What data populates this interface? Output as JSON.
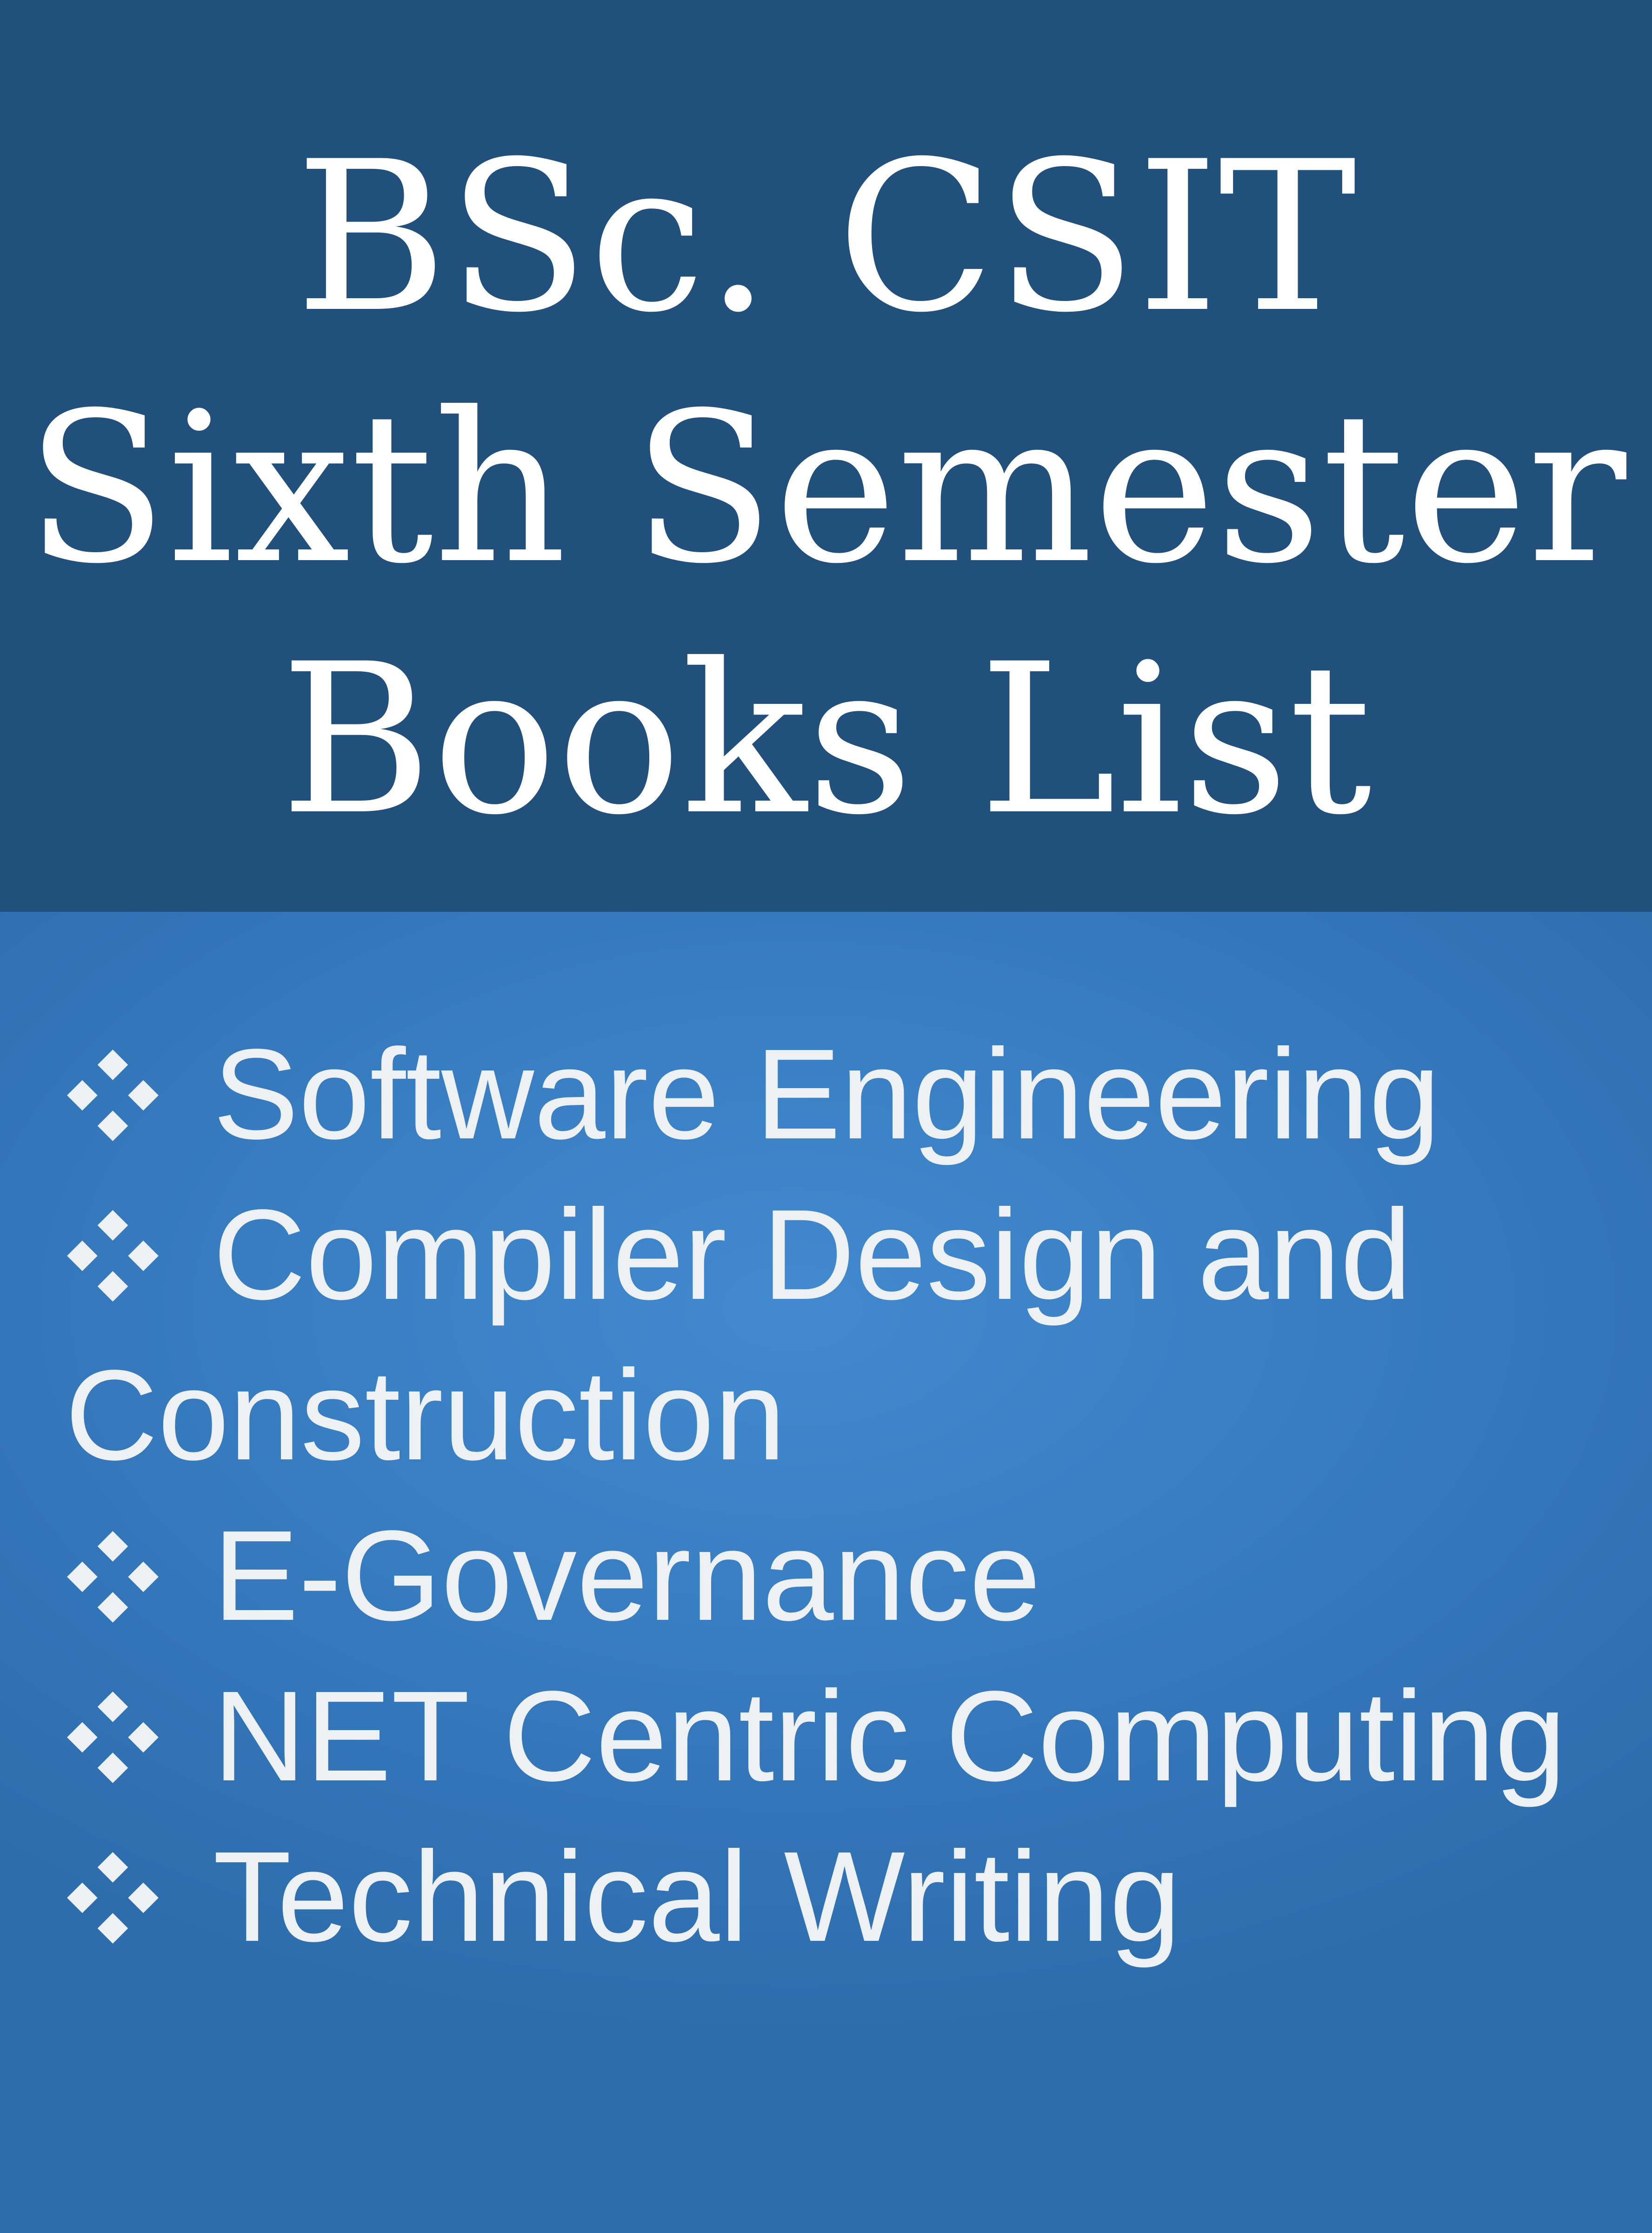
{
  "header": {
    "title_lines": [
      "BSc. CSIT",
      "Sixth Semester",
      "Books List"
    ]
  },
  "books": [
    {
      "lines": [
        "Software Engineering"
      ],
      "icon": "diamond-bullet-icon"
    },
    {
      "lines": [
        "Compiler Design and",
        "Construction"
      ],
      "icon": "diamond-bullet-icon"
    },
    {
      "lines": [
        "E-Governance"
      ],
      "icon": "diamond-bullet-icon"
    },
    {
      "lines": [
        "NET Centric Computing"
      ],
      "icon": "diamond-bullet-icon"
    },
    {
      "lines": [
        "Technical Writing"
      ],
      "icon": "diamond-bullet-icon"
    }
  ],
  "colors": {
    "header_background": "#22507c",
    "content_background": "#3a7fc4",
    "text": "#eef1f4",
    "title_text": "#ffffff"
  }
}
